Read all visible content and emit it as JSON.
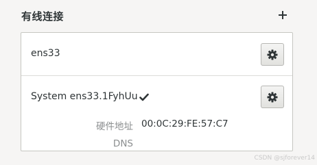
{
  "section": {
    "title": "有线连接",
    "add_icon": "plus-icon"
  },
  "connections": [
    {
      "name": "ens33",
      "settings_icon": "gear-icon"
    },
    {
      "name": "System ens33.1FyhUu",
      "active_icon": "checkmark-icon",
      "settings_icon": "gear-icon",
      "details": {
        "hw_address_label": "硬件地址",
        "hw_address_value": "00:0C:29:FE:57:C7",
        "dns_label": "DNS"
      }
    }
  ],
  "watermark": "CSDN @sjforever14"
}
